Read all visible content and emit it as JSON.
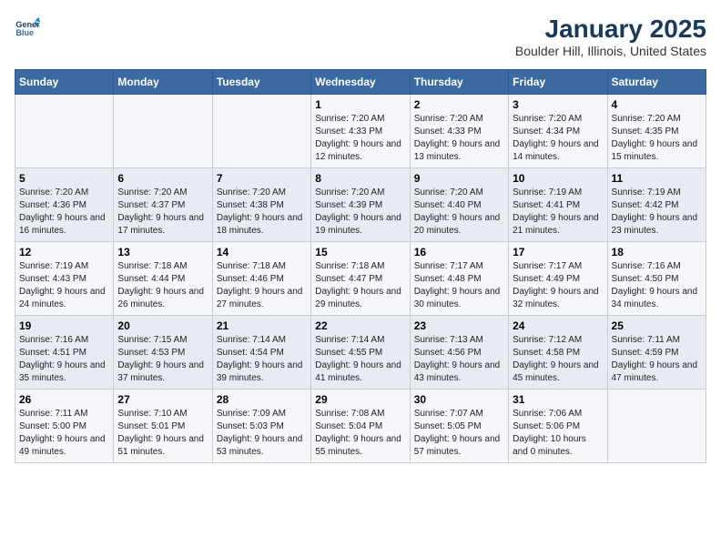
{
  "header": {
    "logo_line1": "General",
    "logo_line2": "Blue",
    "title": "January 2025",
    "subtitle": "Boulder Hill, Illinois, United States"
  },
  "weekdays": [
    "Sunday",
    "Monday",
    "Tuesday",
    "Wednesday",
    "Thursday",
    "Friday",
    "Saturday"
  ],
  "weeks": [
    [
      {
        "day": "",
        "info": ""
      },
      {
        "day": "",
        "info": ""
      },
      {
        "day": "",
        "info": ""
      },
      {
        "day": "1",
        "info": "Sunrise: 7:20 AM\nSunset: 4:33 PM\nDaylight: 9 hours and 12 minutes."
      },
      {
        "day": "2",
        "info": "Sunrise: 7:20 AM\nSunset: 4:33 PM\nDaylight: 9 hours and 13 minutes."
      },
      {
        "day": "3",
        "info": "Sunrise: 7:20 AM\nSunset: 4:34 PM\nDaylight: 9 hours and 14 minutes."
      },
      {
        "day": "4",
        "info": "Sunrise: 7:20 AM\nSunset: 4:35 PM\nDaylight: 9 hours and 15 minutes."
      }
    ],
    [
      {
        "day": "5",
        "info": "Sunrise: 7:20 AM\nSunset: 4:36 PM\nDaylight: 9 hours and 16 minutes."
      },
      {
        "day": "6",
        "info": "Sunrise: 7:20 AM\nSunset: 4:37 PM\nDaylight: 9 hours and 17 minutes."
      },
      {
        "day": "7",
        "info": "Sunrise: 7:20 AM\nSunset: 4:38 PM\nDaylight: 9 hours and 18 minutes."
      },
      {
        "day": "8",
        "info": "Sunrise: 7:20 AM\nSunset: 4:39 PM\nDaylight: 9 hours and 19 minutes."
      },
      {
        "day": "9",
        "info": "Sunrise: 7:20 AM\nSunset: 4:40 PM\nDaylight: 9 hours and 20 minutes."
      },
      {
        "day": "10",
        "info": "Sunrise: 7:19 AM\nSunset: 4:41 PM\nDaylight: 9 hours and 21 minutes."
      },
      {
        "day": "11",
        "info": "Sunrise: 7:19 AM\nSunset: 4:42 PM\nDaylight: 9 hours and 23 minutes."
      }
    ],
    [
      {
        "day": "12",
        "info": "Sunrise: 7:19 AM\nSunset: 4:43 PM\nDaylight: 9 hours and 24 minutes."
      },
      {
        "day": "13",
        "info": "Sunrise: 7:18 AM\nSunset: 4:44 PM\nDaylight: 9 hours and 26 minutes."
      },
      {
        "day": "14",
        "info": "Sunrise: 7:18 AM\nSunset: 4:46 PM\nDaylight: 9 hours and 27 minutes."
      },
      {
        "day": "15",
        "info": "Sunrise: 7:18 AM\nSunset: 4:47 PM\nDaylight: 9 hours and 29 minutes."
      },
      {
        "day": "16",
        "info": "Sunrise: 7:17 AM\nSunset: 4:48 PM\nDaylight: 9 hours and 30 minutes."
      },
      {
        "day": "17",
        "info": "Sunrise: 7:17 AM\nSunset: 4:49 PM\nDaylight: 9 hours and 32 minutes."
      },
      {
        "day": "18",
        "info": "Sunrise: 7:16 AM\nSunset: 4:50 PM\nDaylight: 9 hours and 34 minutes."
      }
    ],
    [
      {
        "day": "19",
        "info": "Sunrise: 7:16 AM\nSunset: 4:51 PM\nDaylight: 9 hours and 35 minutes."
      },
      {
        "day": "20",
        "info": "Sunrise: 7:15 AM\nSunset: 4:53 PM\nDaylight: 9 hours and 37 minutes."
      },
      {
        "day": "21",
        "info": "Sunrise: 7:14 AM\nSunset: 4:54 PM\nDaylight: 9 hours and 39 minutes."
      },
      {
        "day": "22",
        "info": "Sunrise: 7:14 AM\nSunset: 4:55 PM\nDaylight: 9 hours and 41 minutes."
      },
      {
        "day": "23",
        "info": "Sunrise: 7:13 AM\nSunset: 4:56 PM\nDaylight: 9 hours and 43 minutes."
      },
      {
        "day": "24",
        "info": "Sunrise: 7:12 AM\nSunset: 4:58 PM\nDaylight: 9 hours and 45 minutes."
      },
      {
        "day": "25",
        "info": "Sunrise: 7:11 AM\nSunset: 4:59 PM\nDaylight: 9 hours and 47 minutes."
      }
    ],
    [
      {
        "day": "26",
        "info": "Sunrise: 7:11 AM\nSunset: 5:00 PM\nDaylight: 9 hours and 49 minutes."
      },
      {
        "day": "27",
        "info": "Sunrise: 7:10 AM\nSunset: 5:01 PM\nDaylight: 9 hours and 51 minutes."
      },
      {
        "day": "28",
        "info": "Sunrise: 7:09 AM\nSunset: 5:03 PM\nDaylight: 9 hours and 53 minutes."
      },
      {
        "day": "29",
        "info": "Sunrise: 7:08 AM\nSunset: 5:04 PM\nDaylight: 9 hours and 55 minutes."
      },
      {
        "day": "30",
        "info": "Sunrise: 7:07 AM\nSunset: 5:05 PM\nDaylight: 9 hours and 57 minutes."
      },
      {
        "day": "31",
        "info": "Sunrise: 7:06 AM\nSunset: 5:06 PM\nDaylight: 10 hours and 0 minutes."
      },
      {
        "day": "",
        "info": ""
      }
    ]
  ]
}
